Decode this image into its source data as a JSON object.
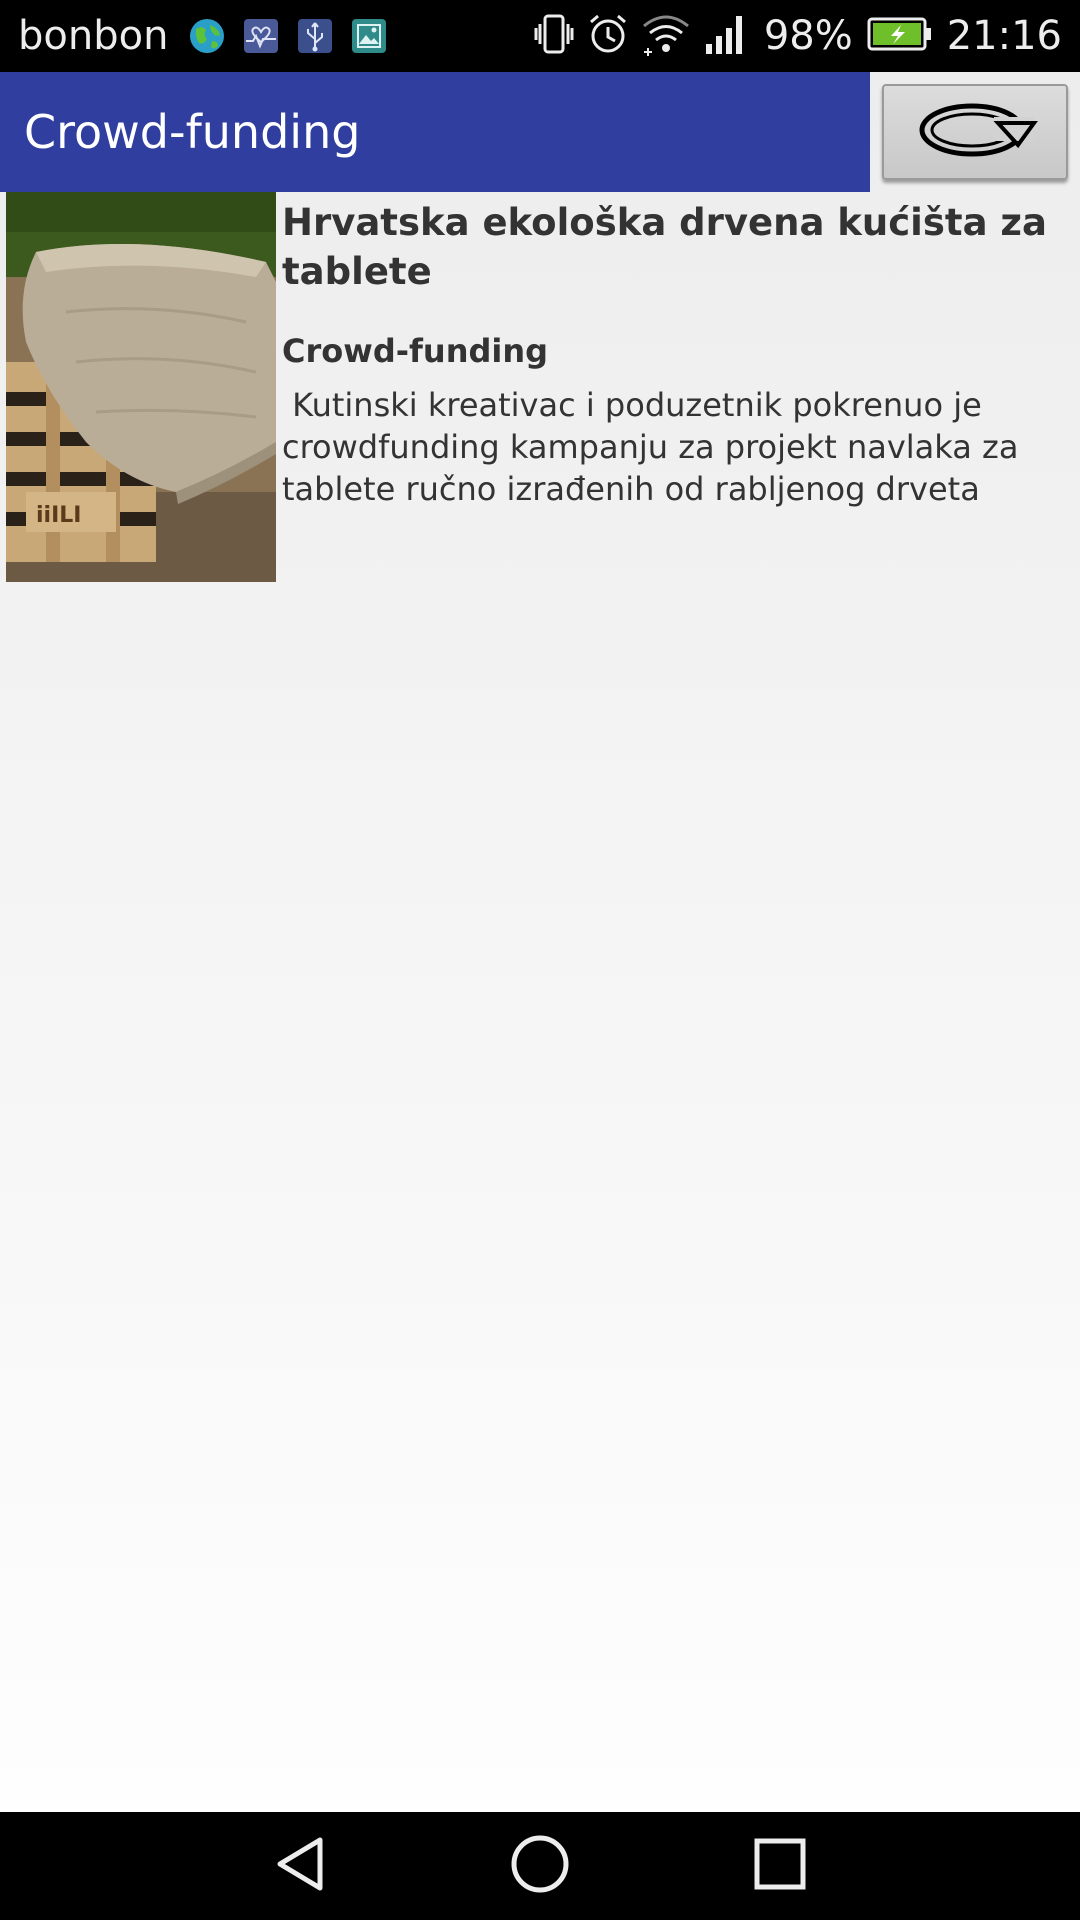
{
  "status_bar": {
    "carrier": "bonbon",
    "battery_percent": "98%",
    "time": "21:16",
    "notification_icons": [
      "globe-icon",
      "health-icon",
      "usb-icon",
      "gallery-icon"
    ],
    "system_icons": [
      "vibrate-icon",
      "alarm-icon",
      "wifi-icon",
      "signal-icon",
      "battery-charging-icon"
    ]
  },
  "app_bar": {
    "title": "Crowd-funding",
    "color": "#303f9f",
    "refresh_icon": "refresh-icon"
  },
  "articles": [
    {
      "title": "Hrvatska ekološka drvena kućišta za tablete",
      "category": "Crowd-funding",
      "description": " Kutinski kreativac i poduzetnik pokrenuo je crowdfunding kampanju za projekt navlaka za tablete ručno izrađenih od rabljenog drveta"
    }
  ],
  "nav_bar": {
    "back_icon": "back-icon",
    "home_icon": "home-icon",
    "recents_icon": "recents-icon"
  }
}
